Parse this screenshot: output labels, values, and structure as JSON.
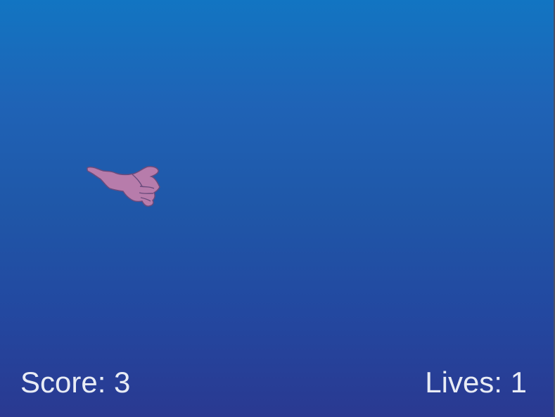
{
  "hud": {
    "score_text": "Score: 3",
    "lives_text": "Lives: 1"
  },
  "player": {
    "icon": "pink-hand-character-icon",
    "color": "#b77cab",
    "outline_color": "#6a4b7c"
  },
  "background": {
    "top_color": "#1275c2",
    "bottom_color": "#2a3991"
  }
}
